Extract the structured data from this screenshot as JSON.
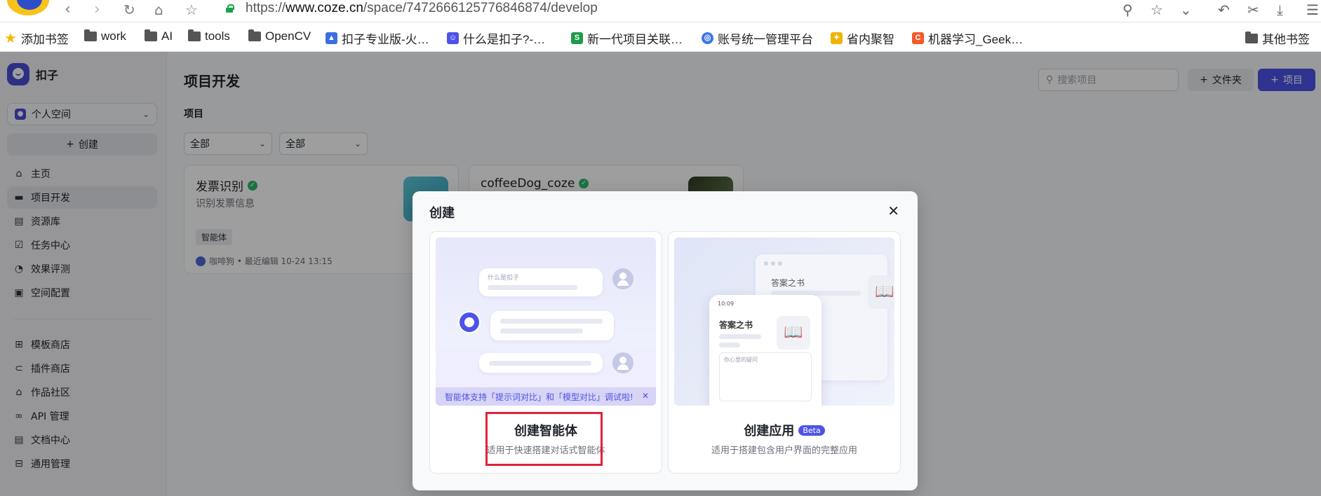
{
  "browser": {
    "url_prefix": "https://",
    "url_host": "www.coze.cn",
    "url_path": "/space/7472666125776846874/develop",
    "bookmarks": [
      {
        "label": "添加书签",
        "type": "star"
      },
      {
        "label": "work",
        "type": "folder"
      },
      {
        "label": "AI",
        "type": "folder"
      },
      {
        "label": "tools",
        "type": "folder"
      },
      {
        "label": "OpenCV",
        "type": "folder"
      },
      {
        "label": "扣子专业版-火…",
        "type": "site"
      },
      {
        "label": "什么是扣子?-…",
        "type": "site"
      },
      {
        "label": "新一代项目关联…",
        "type": "site"
      },
      {
        "label": "账号统一管理平台",
        "type": "site"
      },
      {
        "label": "省内聚智",
        "type": "site"
      },
      {
        "label": "机器学习_Geek…",
        "type": "site"
      },
      {
        "label": "其他书签",
        "type": "folder"
      }
    ]
  },
  "sidebar": {
    "brand": "扣子",
    "space": "个人空间",
    "create": "创建",
    "items": [
      {
        "label": "主页",
        "icon": "home-icon",
        "glyph": "⌂"
      },
      {
        "label": "项目开发",
        "icon": "develop-icon",
        "glyph": "▬"
      },
      {
        "label": "资源库",
        "icon": "library-icon",
        "glyph": "▤"
      },
      {
        "label": "任务中心",
        "icon": "task-icon",
        "glyph": "☑"
      },
      {
        "label": "效果评测",
        "icon": "evaluate-icon",
        "glyph": "◔"
      },
      {
        "label": "空间配置",
        "icon": "config-icon",
        "glyph": "▣"
      }
    ],
    "items2": [
      {
        "label": "模板商店",
        "icon": "template-icon",
        "glyph": "⊞"
      },
      {
        "label": "插件商店",
        "icon": "plugin-icon",
        "glyph": "⊂"
      },
      {
        "label": "作品社区",
        "icon": "community-icon",
        "glyph": "⌂"
      },
      {
        "label": "API 管理",
        "icon": "api-icon",
        "glyph": "∞"
      },
      {
        "label": "文档中心",
        "icon": "docs-icon",
        "glyph": "▤"
      },
      {
        "label": "通用管理",
        "icon": "manage-icon",
        "glyph": "⊟"
      }
    ]
  },
  "main": {
    "title": "项目开发",
    "section": "项目",
    "filter1": "全部",
    "filter2": "全部",
    "search_placeholder": "搜索项目",
    "folder_btn": "文件夹",
    "project_btn": "项目",
    "cards": [
      {
        "title": "发票识别",
        "desc": "识别发票信息",
        "tag": "智能体",
        "meta": "咖啡狗 • 最近编辑 10-24 13:15"
      },
      {
        "title": "coffeeDog_coze",
        "desc": "",
        "tag": "",
        "meta": ""
      }
    ]
  },
  "modal": {
    "title": "创建",
    "agent": {
      "name": "创建智能体",
      "desc": "适用于快速搭建对话式智能体",
      "banner": "智能体支持「提示词对比」和「模型对比」调试啦!",
      "sample_q": "什么是扣子"
    },
    "app": {
      "name": "创建应用",
      "badge": "Beta",
      "desc": "适用于搭建包含用户界面的完整应用",
      "sample_title": "答案之书",
      "sample_time": "10:09",
      "sample_input": "你心里的疑问"
    }
  }
}
